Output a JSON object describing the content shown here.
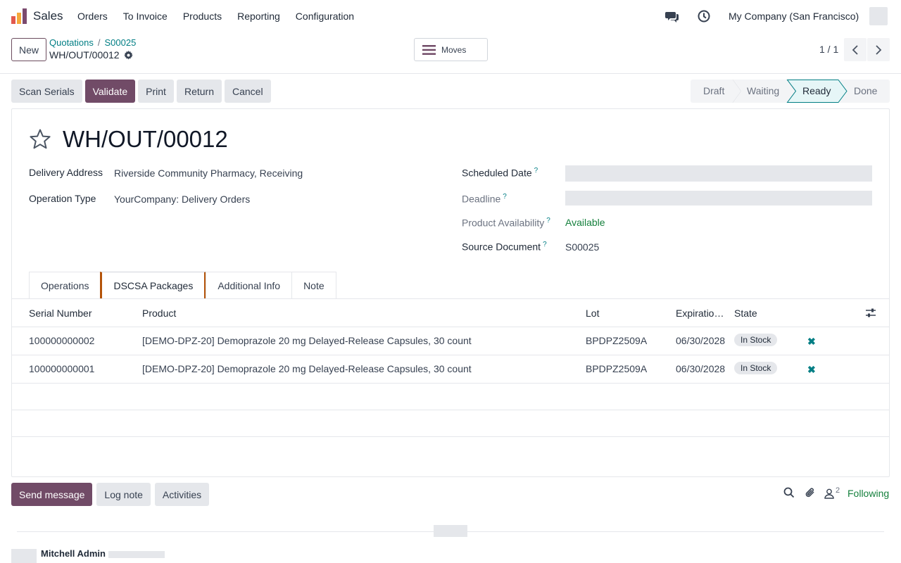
{
  "navbar": {
    "app_name": "Sales",
    "menu": [
      "Orders",
      "To Invoice",
      "Products",
      "Reporting",
      "Configuration"
    ],
    "company": "My Company (San Francisco)",
    "icons": [
      "chat-icon",
      "clock-icon"
    ]
  },
  "control": {
    "new_label": "New",
    "breadcrumb": [
      "Quotations",
      "S00025"
    ],
    "breadcrumb_sep": "/",
    "record_name": "WH/OUT/00012",
    "moves_label": "Moves",
    "pager": "1 / 1"
  },
  "actions": {
    "scan_serials": "Scan Serials",
    "validate": "Validate",
    "print": "Print",
    "return": "Return",
    "cancel": "Cancel"
  },
  "stages": [
    "Draft",
    "Waiting",
    "Ready",
    "Done"
  ],
  "active_stage": "Ready",
  "form": {
    "title": "WH/OUT/00012",
    "delivery_address_label": "Delivery Address",
    "delivery_address": "Riverside Community Pharmacy, Receiving",
    "operation_type_label": "Operation Type",
    "operation_type": "YourCompany: Delivery Orders",
    "scheduled_date_label": "Scheduled Date",
    "deadline_label": "Deadline",
    "availability_label": "Product Availability",
    "availability": "Available",
    "source_doc_label": "Source Document",
    "source_doc": "S00025",
    "help_mark": "?"
  },
  "tabs": [
    "Operations",
    "DSCSA Packages",
    "Additional Info",
    "Note"
  ],
  "table": {
    "headers": [
      "Serial Number",
      "Product",
      "Lot",
      "Expiratio…",
      "State"
    ],
    "rows": [
      {
        "serial": "100000000002",
        "product": "[DEMO-DPZ-20] Demoprazole 20 mg Delayed-Release Capsules, 30 count",
        "lot": "BPDPZ2509A",
        "expiration": "06/30/2028",
        "state": "In Stock"
      },
      {
        "serial": "100000000001",
        "product": "[DEMO-DPZ-20] Demoprazole 20 mg Delayed-Release Capsules, 30 count",
        "lot": "BPDPZ2509A",
        "expiration": "06/30/2028",
        "state": "In Stock"
      }
    ]
  },
  "chatter": {
    "send_message": "Send message",
    "log_note": "Log note",
    "activities": "Activities",
    "followers_count": "2",
    "following": "Following",
    "author": "Mitchell Admin"
  },
  "colors": {
    "primary": "#714b67",
    "link": "#017e84",
    "success": "#15803d"
  }
}
